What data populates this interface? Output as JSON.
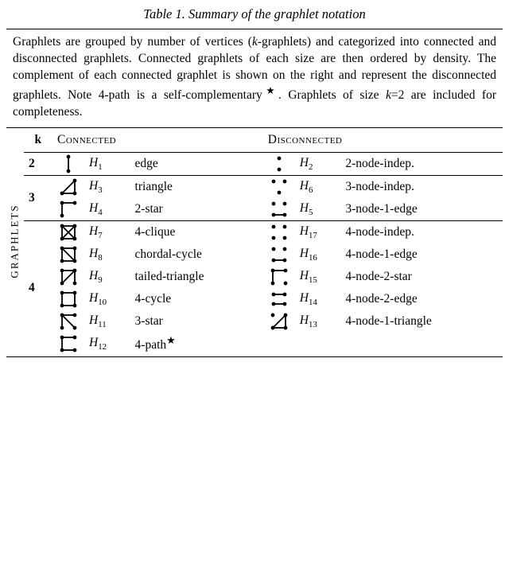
{
  "title_prefix": "Table 1.",
  "title_rest": " Summary of the graphlet notation",
  "caption": "Graphlets are grouped by number of vertices (k-graphlets) and categorized into connected and disconnected graphlets. Connected graphlets of each size are then ordered by density. The complement of each connected graphlet is shown on the right and represent the disconnected graphlets. Note 4-path is a self-complementary★. Graphlets of size k=2 are included for completeness.",
  "side_label": "GRAPHLETS",
  "headers": {
    "k": "k",
    "connected": "Connected",
    "disconnected": "Disconnected"
  },
  "chart_data": {
    "type": "table",
    "groups": [
      {
        "k": 2,
        "rows": [
          {
            "connected": {
              "H": 1,
              "name": "edge",
              "icon": "edge"
            },
            "disconnected": {
              "H": 2,
              "name": "2-node-indep.",
              "icon": "2indep"
            }
          }
        ]
      },
      {
        "k": 3,
        "rows": [
          {
            "connected": {
              "H": 3,
              "name": "triangle",
              "icon": "triangle"
            },
            "disconnected": {
              "H": 6,
              "name": "3-node-indep.",
              "icon": "3indep"
            }
          },
          {
            "connected": {
              "H": 4,
              "name": "2-star",
              "icon": "2star"
            },
            "disconnected": {
              "H": 5,
              "name": "3-node-1-edge",
              "icon": "3n1e"
            }
          }
        ]
      },
      {
        "k": 4,
        "rows": [
          {
            "connected": {
              "H": 7,
              "name": "4-clique",
              "icon": "4clique"
            },
            "disconnected": {
              "H": 17,
              "name": "4-node-indep.",
              "icon": "4indep"
            }
          },
          {
            "connected": {
              "H": 8,
              "name": "chordal-cycle",
              "icon": "chordal"
            },
            "disconnected": {
              "H": 16,
              "name": "4-node-1-edge",
              "icon": "4n1e"
            }
          },
          {
            "connected": {
              "H": 9,
              "name": "tailed-triangle",
              "icon": "tailedtri"
            },
            "disconnected": {
              "H": 15,
              "name": "4-node-2-star",
              "icon": "4n2star"
            }
          },
          {
            "connected": {
              "H": 10,
              "name": "4-cycle",
              "icon": "4cycle"
            },
            "disconnected": {
              "H": 14,
              "name": "4-node-2-edge",
              "icon": "4n2e"
            }
          },
          {
            "connected": {
              "H": 11,
              "name": "3-star",
              "icon": "3star"
            },
            "disconnected": {
              "H": 13,
              "name": "4-node-1-triangle",
              "icon": "4n1tri"
            }
          },
          {
            "connected": {
              "H": 12,
              "name": "4-path★",
              "icon": "4path"
            },
            "disconnected": null
          }
        ]
      }
    ]
  }
}
